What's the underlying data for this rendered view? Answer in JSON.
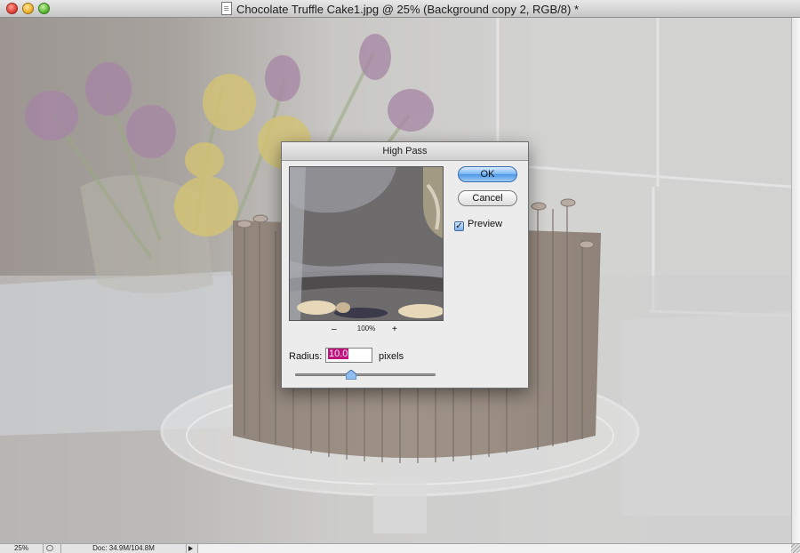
{
  "window": {
    "title": "Chocolate Truffle Cake1.jpg @ 25% (Background copy 2, RGB/8) *",
    "doc_icon": "document-icon"
  },
  "statusbar": {
    "zoom": "25%",
    "doc_info": "Doc: 34.9M/104.8M"
  },
  "dialog": {
    "title": "High Pass",
    "ok_label": "OK",
    "cancel_label": "Cancel",
    "preview_label": "Preview",
    "preview_checked": true,
    "zoom_minus": "–",
    "zoom_percent": "100%",
    "zoom_plus": "+",
    "radius_label": "Radius:",
    "radius_value": "10.0",
    "radius_unit": "pixels"
  },
  "colors": {
    "selection": "#c0127c",
    "ok_button": "#5aa2ec"
  }
}
